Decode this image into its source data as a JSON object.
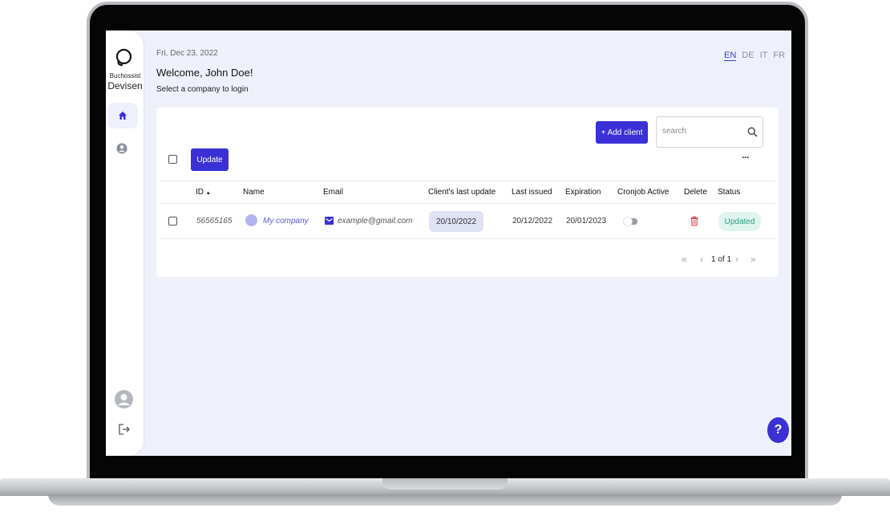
{
  "brand": {
    "line1": "Buchossist",
    "line2": "Devisen"
  },
  "header": {
    "date": "Fri, Dec 23, 2022",
    "welcome": "Welcome, John Doe!",
    "subtitle": "Select a company to login"
  },
  "languages": [
    {
      "code": "EN",
      "active": true
    },
    {
      "code": "DE",
      "active": false
    },
    {
      "code": "IT",
      "active": false
    },
    {
      "code": "FR",
      "active": false
    }
  ],
  "toolbar": {
    "add_client_label": "+ Add client",
    "search_placeholder": "search",
    "update_label": "Update",
    "more_label": "···"
  },
  "table": {
    "columns": [
      "ID",
      "Name",
      "Email",
      "Client's last update",
      "Last issued",
      "Expiration",
      "Cronjob Active",
      "Delete",
      "Status"
    ],
    "sort_indicator": "▲",
    "rows": [
      {
        "id": "56565165",
        "name": "My company",
        "email": "example@gmail.com",
        "last_update": "20/10/2022",
        "last_issued": "20/12/2022",
        "expiration": "20/01/2023",
        "cronjob_active": false,
        "status": "Updated"
      }
    ]
  },
  "pagination": {
    "first": "«",
    "prev": "‹",
    "info": "1 of 1",
    "next": "›",
    "last": "»"
  },
  "help_label": "?",
  "colors": {
    "accent": "#3b30d6",
    "status_bg": "#e0f4ef",
    "status_text": "#2a9d82",
    "delete": "#e0454f",
    "screen_bg": "#eef1fa"
  }
}
